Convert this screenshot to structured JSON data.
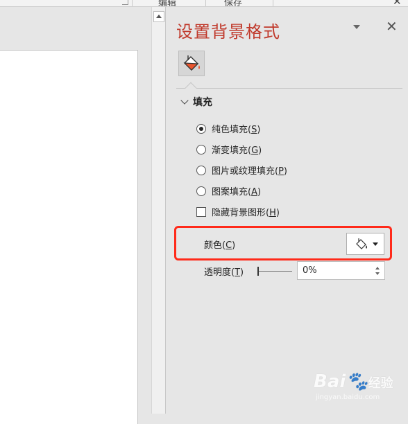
{
  "ribbon": {
    "group1": "编辑",
    "group2": "保存"
  },
  "pane": {
    "title": "设置背景格式",
    "menu_icon": "chevron-down-icon",
    "close_icon": "close-icon",
    "tab_icon": "paint-bucket-icon",
    "accent_color": "#c0392b"
  },
  "fill": {
    "section_label": "填充",
    "options": [
      {
        "text": "纯色填充(",
        "key": "S",
        "end": ")",
        "checked": true
      },
      {
        "text": "渐变填充(",
        "key": "G",
        "end": ")",
        "checked": false
      },
      {
        "text": "图片或纹理填充(",
        "key": "P",
        "end": ")",
        "checked": false
      },
      {
        "text": "图案填充(",
        "key": "A",
        "end": ")",
        "checked": false
      }
    ],
    "hide_bg": {
      "text": "隐藏背景图形(",
      "key": "H",
      "end": ")",
      "checked": false
    },
    "color": {
      "text": "颜色(",
      "key": "C",
      "end": ")",
      "highlight_color": "#ff2a1a"
    },
    "transparency": {
      "text": "透明度(",
      "key": "T",
      "end": ")",
      "value": "0%",
      "level": 0
    }
  },
  "watermark": {
    "brand": "Bai",
    "brand2": "经验",
    "url": "jingyan.baidu.com"
  }
}
